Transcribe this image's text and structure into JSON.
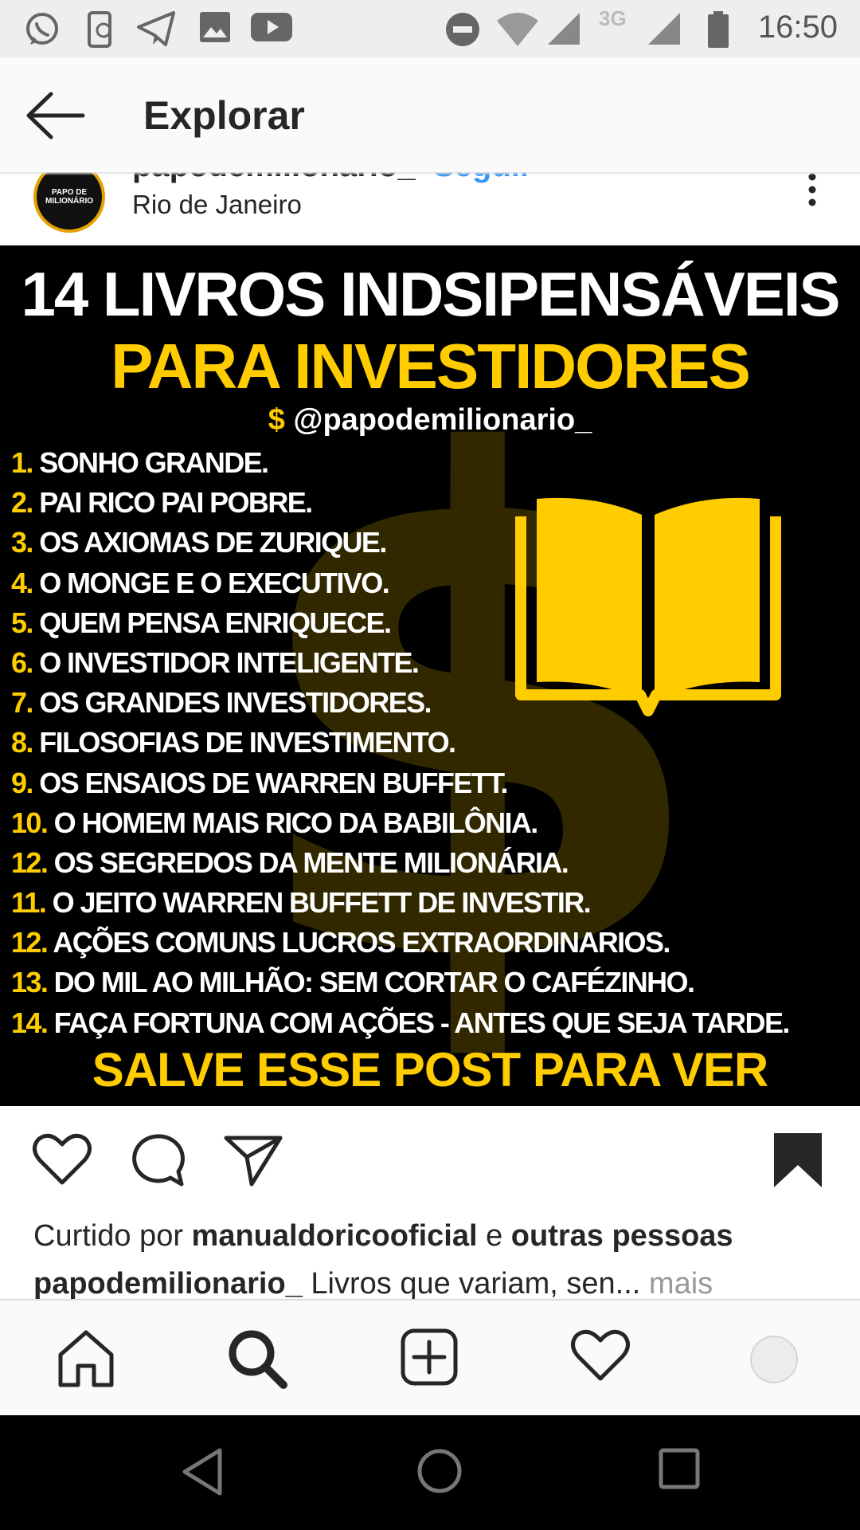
{
  "status_bar": {
    "time": "16:50",
    "network": "3G",
    "icons": [
      "whatsapp-icon",
      "phone-sync-icon",
      "telegram-icon",
      "gallery-icon",
      "youtube-icon",
      "do-not-disturb-icon",
      "wifi-icon",
      "signal-icon",
      "battery-icon"
    ]
  },
  "header": {
    "title": "Explorar"
  },
  "post": {
    "username": "papodemilionario_",
    "follow_label": "Seguir",
    "location": "Rio de Janeiro",
    "avatar": {
      "line1": "PAPO DE",
      "line2": "MILIONÁRIO"
    },
    "image": {
      "title": "14 LIVROS INDSIPENSÁVEIS",
      "subtitle": "PARA INVESTIDORES",
      "handle_symbol": "$",
      "handle": "@papodemilionario_",
      "books": [
        {
          "num": "1.",
          "title": "SONHO GRANDE."
        },
        {
          "num": "2.",
          "title": "PAI RICO PAI POBRE."
        },
        {
          "num": "3.",
          "title": "OS AXIOMAS DE ZURIQUE."
        },
        {
          "num": "4.",
          "title": "O MONGE E O EXECUTIVO."
        },
        {
          "num": "5.",
          "title": "QUEM PENSA ENRIQUECE."
        },
        {
          "num": "6.",
          "title": "O INVESTIDOR INTELIGENTE."
        },
        {
          "num": "7.",
          "title": "OS GRANDES INVESTIDORES."
        },
        {
          "num": "8.",
          "title": "FILOSOFIAS DE INVESTIMENTO."
        },
        {
          "num": "9.",
          "title": "OS ENSAIOS DE WARREN BUFFETT."
        },
        {
          "num": "10.",
          "title": "O HOMEM MAIS RICO DA BABILÔNIA."
        },
        {
          "num": "12.",
          "title": "OS SEGREDOS DA MENTE MILIONÁRIA."
        },
        {
          "num": "11.",
          "title": "O JEITO WARREN BUFFETT DE INVESTIR."
        },
        {
          "num": "12.",
          "title": "AÇÕES COMUNS LUCROS EXTRAORDINARIOS."
        },
        {
          "num": "13.",
          "title": "DO MIL AO MILHÃO: SEM CORTAR O CAFÉZINHO."
        },
        {
          "num": "14.",
          "title": "FAÇA FORTUNA COM AÇÕES - ANTES QUE SEJA TARDE."
        }
      ],
      "footer": "SALVE ESSE POST PARA VER DEPOIS!",
      "accent_color": "#ffcc00"
    },
    "likes": {
      "prefix": "Curtido por",
      "user": "manualdoricooficial",
      "conj": "e",
      "others": "outras pessoas"
    },
    "caption": {
      "user": "papodemilionario_",
      "text": "Livros que variam, sen...",
      "more": "mais"
    }
  },
  "bottom_nav": [
    "home-icon",
    "search-icon",
    "add-post-icon",
    "activity-heart-icon",
    "profile-avatar"
  ],
  "colors": {
    "link": "#3897f0",
    "accent": "#ffcc00"
  }
}
